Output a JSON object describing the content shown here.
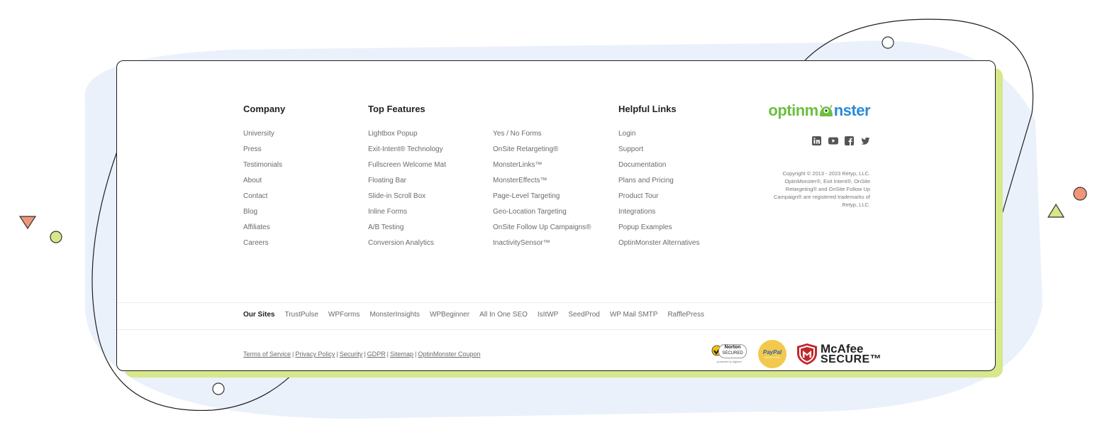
{
  "footer": {
    "company": {
      "heading": "Company",
      "items": [
        "University",
        "Press",
        "Testimonials",
        "About",
        "Contact",
        "Blog",
        "Affiliates",
        "Careers"
      ]
    },
    "top_features": {
      "heading": "Top Features",
      "items_col1": [
        "Lightbox Popup",
        "Exit-Intent® Technology",
        "Fullscreen Welcome Mat",
        "Floating Bar",
        "Slide-in Scroll Box",
        "Inline Forms",
        "A/B Testing",
        "Conversion Analytics"
      ],
      "items_col2": [
        "Yes / No Forms",
        "OnSite Retargeting®",
        "MonsterLinks™",
        "MonsterEffects™",
        "Page-Level Targeting",
        "Geo-Location Targeting",
        "OnSite Follow Up Campaigns®",
        "InactivitySensor™"
      ]
    },
    "helpful_links": {
      "heading": "Helpful Links",
      "items": [
        "Login",
        "Support",
        "Documentation",
        "Plans and Pricing",
        "Product Tour",
        "Integrations",
        "Popup Examples",
        "OptinMonster Alternatives"
      ]
    },
    "brand": {
      "logo_part1": "optin",
      "logo_part2": "m",
      "logo_part3": "nster",
      "social_icons": [
        "linkedin-icon",
        "youtube-icon",
        "facebook-icon",
        "twitter-icon"
      ],
      "copyright_lines": [
        "Copyright © 2013 - 2023 Retyp, LLC.",
        "OptinMonster®, Exit Intent®, OnSite",
        "Retargeting® and OnSite Follow Up",
        "Campaign® are registered trademarks of",
        "Retyp, LLC."
      ]
    },
    "our_sites": {
      "label": "Our Sites",
      "items": [
        "TrustPulse",
        "WPForms",
        "MonsterInsights",
        "WPBeginner",
        "All In One SEO",
        "IsItWP",
        "SeedProd",
        "WP Mail SMTP",
        "RafflePress"
      ]
    },
    "legal": {
      "items": [
        "Terms of Service",
        "Privacy Policy",
        "Security",
        "GDPR",
        "Sitemap",
        "OptinMonster Coupon"
      ],
      "separator": "|"
    },
    "badges": {
      "norton_title": "Norton",
      "norton_sub": "SECURED",
      "norton_powered": "powered by digicert",
      "paypal_title": "PayPal",
      "paypal_sub": "VERIFIED",
      "mcafee_line1": "McAfee",
      "mcafee_line2": "SECURE™"
    }
  },
  "colors": {
    "accent_green": "#6cbf3f",
    "accent_blue": "#2a8bd6",
    "card_shadow": "#d6e88a",
    "blob": "#e8f0fb",
    "coral": "#f0957a"
  }
}
